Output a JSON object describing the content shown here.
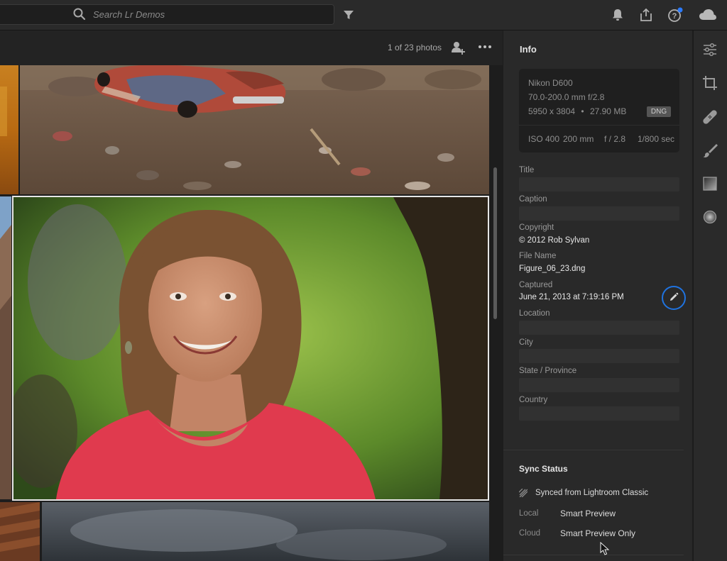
{
  "search": {
    "placeholder": "Search Lr Demos"
  },
  "grid": {
    "photo_count": "1 of 23 photos"
  },
  "info": {
    "title": "Info",
    "camera": {
      "model": "Nikon D600",
      "lens": "70.0-200.0 mm f/2.8",
      "dimensions": "5950 x 3804",
      "separator": "•",
      "file_size": "27.90 MB",
      "format_badge": "DNG",
      "iso": "ISO 400",
      "focal_length": "200 mm",
      "aperture": "f / 2.8",
      "shutter": "1/800 sec"
    },
    "fields": {
      "title_label": "Title",
      "caption_label": "Caption",
      "copyright_label": "Copyright",
      "copyright_value": "© 2012 Rob Sylvan",
      "filename_label": "File Name",
      "filename_value": "Figure_06_23.dng",
      "captured_label": "Captured",
      "captured_value": "June 21, 2013 at 7:19:16 PM",
      "location_label": "Location",
      "city_label": "City",
      "state_label": "State / Province",
      "country_label": "Country"
    }
  },
  "sync": {
    "title": "Sync Status",
    "synced_text": "Synced from Lightroom Classic",
    "local_label": "Local",
    "local_value": "Smart Preview",
    "cloud_label": "Cloud",
    "cloud_value": "Smart Preview Only"
  },
  "colors": {
    "accent": "#1f73e0",
    "notification_dot": "#2b7bff"
  },
  "icons": {
    "topbar": [
      "search-icon",
      "filter-icon",
      "bell-icon",
      "share-icon",
      "help-icon",
      "cloud-icon"
    ],
    "grid_header": [
      "add-person-icon",
      "more-icon"
    ],
    "right_toolbar": [
      "edit-sliders-icon",
      "crop-icon",
      "healing-icon",
      "brush-icon",
      "gradient-icon",
      "radial-icon"
    ]
  }
}
